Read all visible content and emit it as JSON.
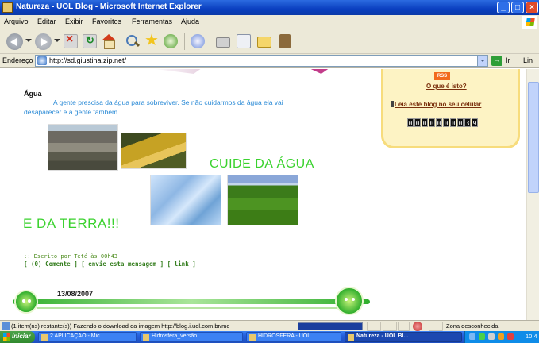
{
  "window": {
    "title": "Natureza - UOL Blog - Microsoft Internet Explorer",
    "controls": [
      "_",
      "□",
      "×"
    ]
  },
  "menu": [
    "Arquivo",
    "Editar",
    "Exibir",
    "Favoritos",
    "Ferramentas",
    "Ajuda"
  ],
  "toolbar_icons": [
    "back-icon",
    "forward-icon",
    "stop-icon",
    "refresh-icon",
    "home-icon",
    "search-icon",
    "favorites-icon",
    "history-icon",
    "mail-icon",
    "print-icon",
    "edit-icon",
    "folder-icon",
    "messenger-icon"
  ],
  "address": {
    "label": "Endereço",
    "url": "http://sd.giustina.zip.net/",
    "go_label": "Ir",
    "links_label": "Lin"
  },
  "post": {
    "title": "Água",
    "body": "A gente prescisa da água para sobreviver. Se não cuidarmos da água ela vai desaparecer e a gente também.",
    "headline1": "CUIDE DA ÁGUA",
    "headline2": "E DA TERRA!!!",
    "meta": ":: Escrito por Teté às 00h43",
    "links_prefix": "[ (0) ",
    "comments_link": "Comente",
    "links_mid1": " ] [ ",
    "send_link": "envie esta mensagem",
    "links_mid2": " ] [ ",
    "permalink": "link",
    "links_suffix": " ]"
  },
  "date_banner": "13/08/2007",
  "sidebar": {
    "rss": "RSS",
    "what_is": "O que é isto?",
    "mobile": "Leia este blog no seu celular",
    "counter": [
      "0",
      "0",
      "0",
      "0",
      "0",
      "0",
      "0",
      "0",
      "3",
      "9"
    ]
  },
  "status": {
    "text": "(1 item(ns) restante(s)) Fazendo o download da imagem http://blog.i.uol.com.br/mc",
    "zone": "Zona desconhecida"
  },
  "taskbar": {
    "start": "Iniciar",
    "tasks": [
      {
        "label": "2 APLICAÇÃO - Mic...",
        "active": false
      },
      {
        "label": "Hidrosfera_versão ...",
        "active": false
      },
      {
        "label": "HIDROSFERA - UOL ...",
        "active": false
      },
      {
        "label": "Natureza - UOL Bl...",
        "active": true
      }
    ],
    "clock": "10:4"
  }
}
